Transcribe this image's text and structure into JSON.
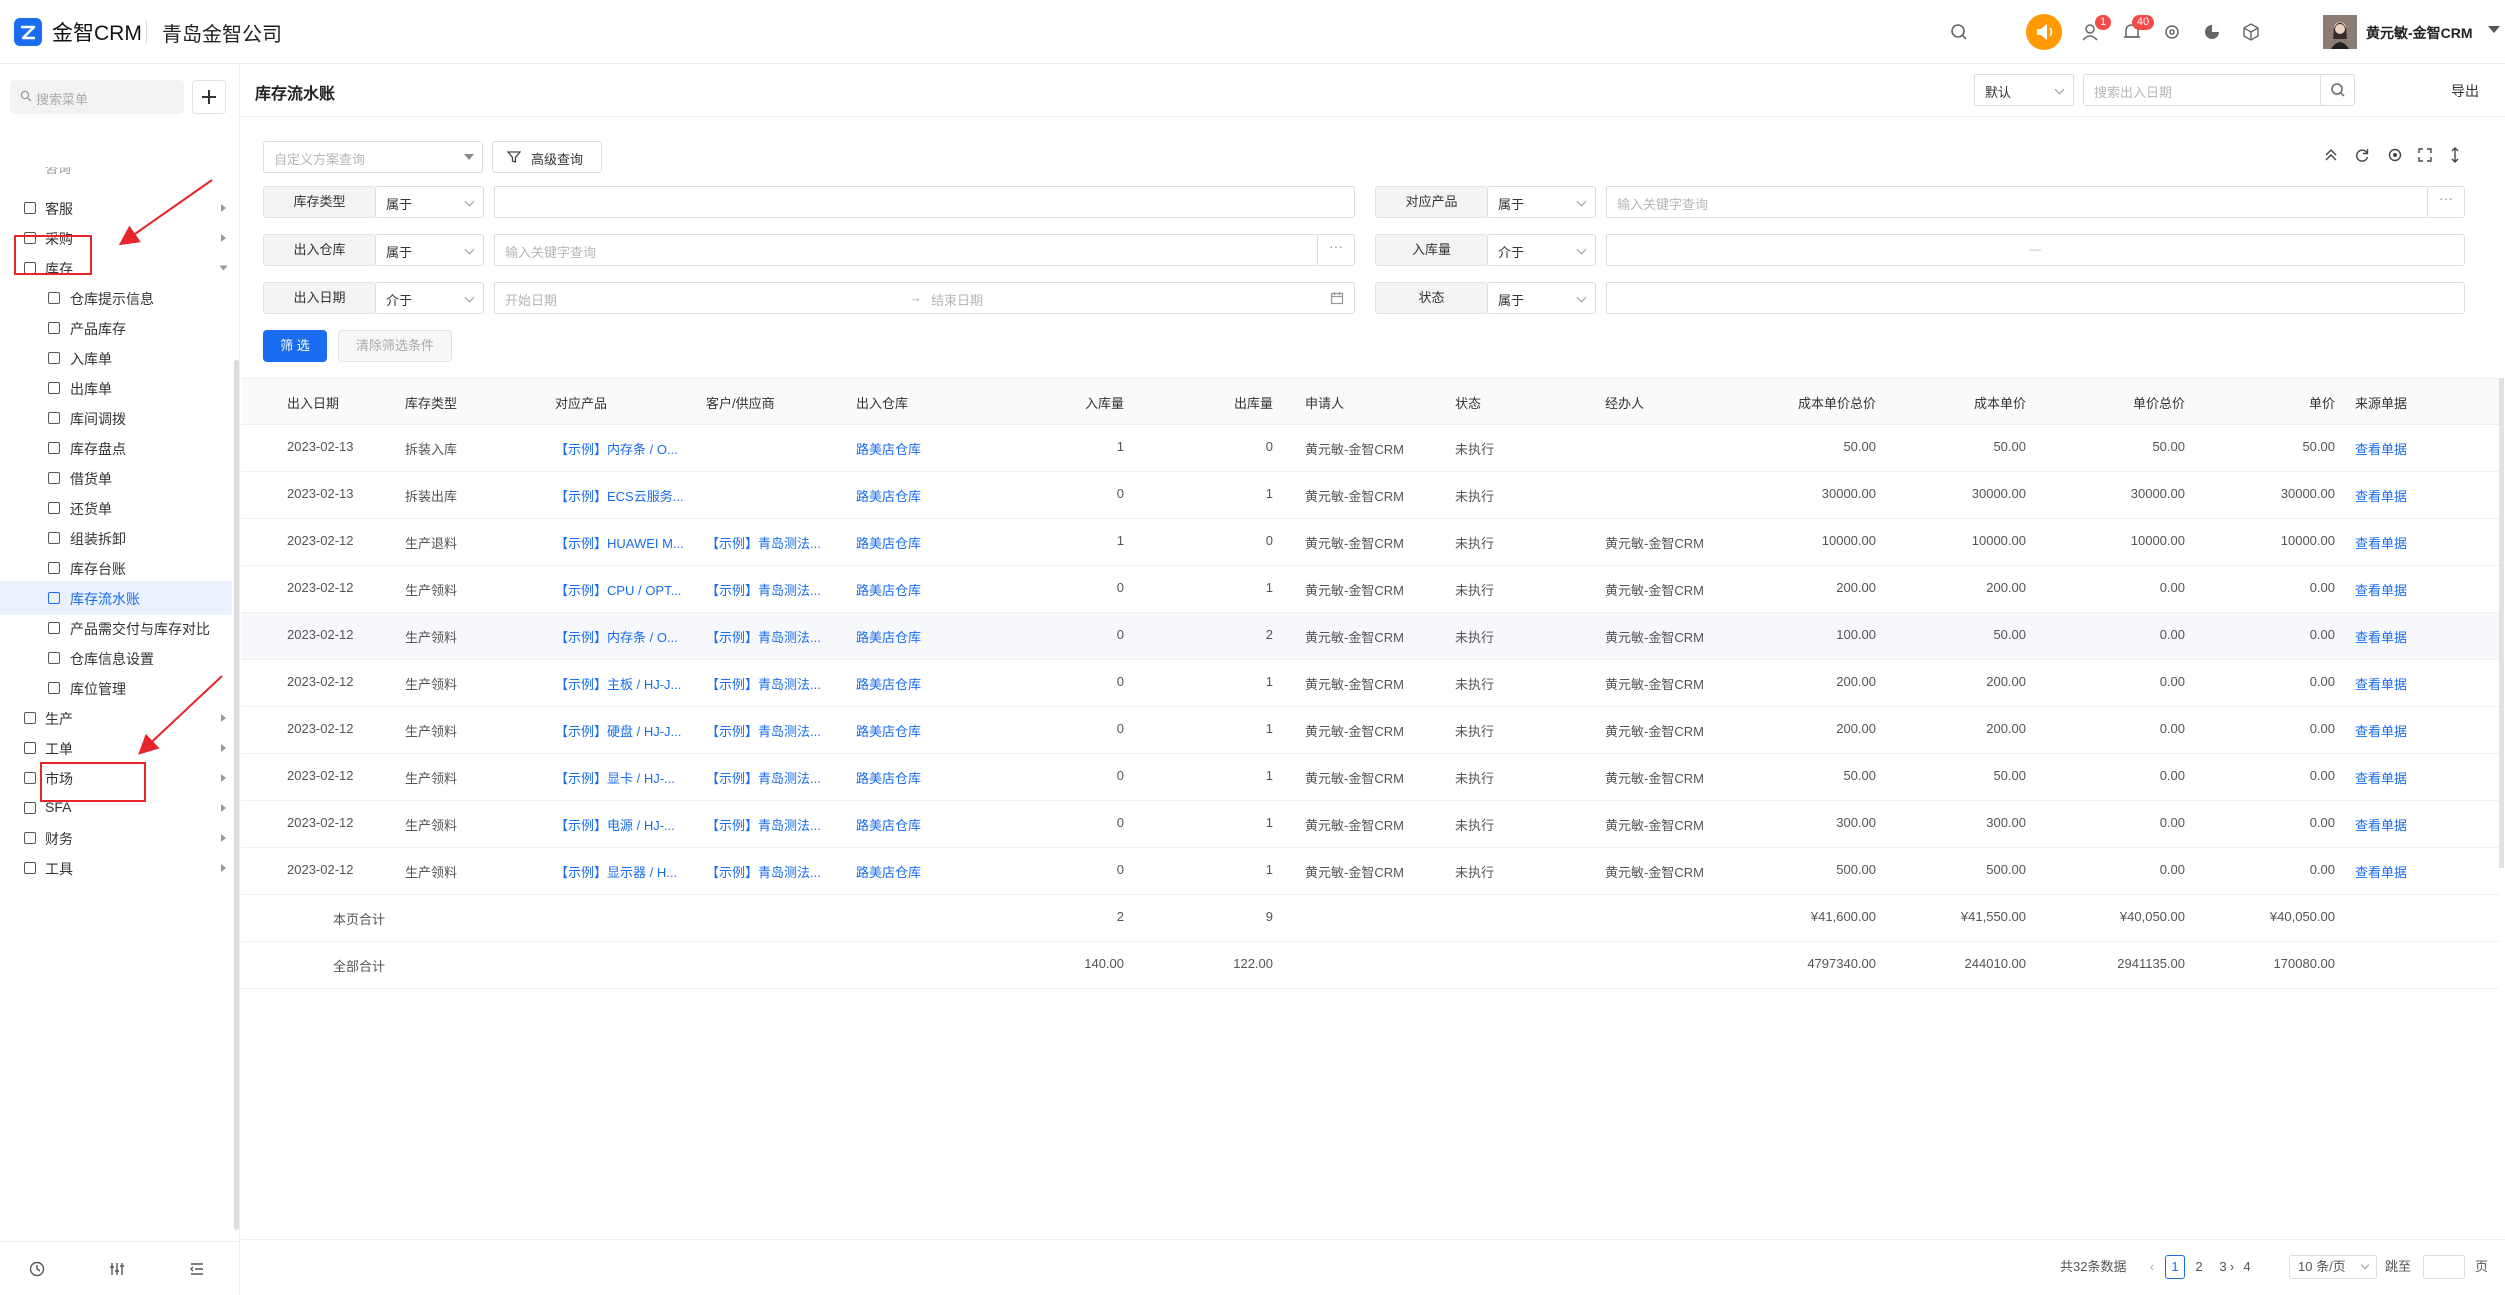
{
  "app": {
    "name": "金智CRM",
    "company": "青岛金智公司"
  },
  "header": {
    "notif_badge_1": "1",
    "notif_badge_2": "40",
    "username": "黄元敏-金智CRM",
    "icons": [
      "search-icon",
      "speaker-icon",
      "users-icon",
      "bell-icon",
      "gear-icon",
      "pie-chart-icon",
      "box-icon"
    ]
  },
  "sidebar": {
    "search_placeholder": "搜索菜单",
    "partial_item": "咨询",
    "items": [
      {
        "label": "客服",
        "level": "top"
      },
      {
        "label": "采购",
        "level": "top"
      },
      {
        "label": "库存",
        "level": "top",
        "expanded": true
      },
      {
        "label": "仓库提示信息",
        "level": "sub"
      },
      {
        "label": "产品库存",
        "level": "sub"
      },
      {
        "label": "入库单",
        "level": "sub"
      },
      {
        "label": "出库单",
        "level": "sub"
      },
      {
        "label": "库间调拨",
        "level": "sub"
      },
      {
        "label": "库存盘点",
        "level": "sub"
      },
      {
        "label": "借货单",
        "level": "sub"
      },
      {
        "label": "还货单",
        "level": "sub"
      },
      {
        "label": "组装拆卸",
        "level": "sub"
      },
      {
        "label": "库存台账",
        "level": "sub"
      },
      {
        "label": "库存流水账",
        "level": "sub",
        "active": true
      },
      {
        "label": "产品需交付与库存对比",
        "level": "sub"
      },
      {
        "label": "仓库信息设置",
        "level": "sub"
      },
      {
        "label": "库位管理",
        "level": "sub"
      },
      {
        "label": "生产",
        "level": "top"
      },
      {
        "label": "工单",
        "level": "top"
      },
      {
        "label": "市场",
        "level": "top"
      },
      {
        "label": "SFA",
        "level": "top"
      },
      {
        "label": "财务",
        "level": "top"
      },
      {
        "label": "工具",
        "level": "top"
      }
    ]
  },
  "page": {
    "title": "库存流水账",
    "view_select": "默认",
    "date_search_placeholder": "搜索出入日期",
    "export": "导出",
    "scheme_placeholder": "自定义方案查询",
    "advanced_query": "高级查询"
  },
  "filters": {
    "stock_type": {
      "label": "库存类型",
      "op": "属于"
    },
    "product": {
      "label": "对应产品",
      "op": "属于",
      "placeholder": "输入关键字查询"
    },
    "warehouse": {
      "label": "出入仓库",
      "op": "属于",
      "placeholder": "输入关键字查询"
    },
    "in_qty": {
      "label": "入库量",
      "op": "介于",
      "sep": "—"
    },
    "date": {
      "label": "出入日期",
      "op": "介于",
      "start": "开始日期",
      "arrow": "→",
      "end": "结束日期"
    },
    "status": {
      "label": "状态",
      "op": "属于"
    },
    "filter_btn": "筛 选",
    "clear_btn": "清除筛选条件"
  },
  "table": {
    "columns": [
      "出入日期",
      "库存类型",
      "对应产品",
      "客户/供应商",
      "出入仓库",
      "入库量",
      "出库量",
      "申请人",
      "状态",
      "经办人",
      "成本单价总价",
      "成本单价",
      "单价总价",
      "单价",
      "来源单据"
    ],
    "rows": [
      [
        "2023-02-13",
        "拆装入库",
        "【示例】内存条 / O...",
        "",
        "路美店仓库",
        "1",
        "0",
        "黄元敏-金智CRM",
        "未执行",
        "",
        "50.00",
        "50.00",
        "50.00",
        "50.00",
        "查看单据"
      ],
      [
        "2023-02-13",
        "拆装出库",
        "【示例】ECS云服务...",
        "",
        "路美店仓库",
        "0",
        "1",
        "黄元敏-金智CRM",
        "未执行",
        "",
        "30000.00",
        "30000.00",
        "30000.00",
        "30000.00",
        "查看单据"
      ],
      [
        "2023-02-12",
        "生产退料",
        "【示例】HUAWEI M...",
        "【示例】青岛测法...",
        "路美店仓库",
        "1",
        "0",
        "黄元敏-金智CRM",
        "未执行",
        "黄元敏-金智CRM",
        "10000.00",
        "10000.00",
        "10000.00",
        "10000.00",
        "查看单据"
      ],
      [
        "2023-02-12",
        "生产领料",
        "【示例】CPU / OPT...",
        "【示例】青岛测法...",
        "路美店仓库",
        "0",
        "1",
        "黄元敏-金智CRM",
        "未执行",
        "黄元敏-金智CRM",
        "200.00",
        "200.00",
        "0.00",
        "0.00",
        "查看单据"
      ],
      [
        "2023-02-12",
        "生产领料",
        "【示例】内存条 / O...",
        "【示例】青岛测法...",
        "路美店仓库",
        "0",
        "2",
        "黄元敏-金智CRM",
        "未执行",
        "黄元敏-金智CRM",
        "100.00",
        "50.00",
        "0.00",
        "0.00",
        "查看单据"
      ],
      [
        "2023-02-12",
        "生产领料",
        "【示例】主板 / HJ-J...",
        "【示例】青岛测法...",
        "路美店仓库",
        "0",
        "1",
        "黄元敏-金智CRM",
        "未执行",
        "黄元敏-金智CRM",
        "200.00",
        "200.00",
        "0.00",
        "0.00",
        "查看单据"
      ],
      [
        "2023-02-12",
        "生产领料",
        "【示例】硬盘 / HJ-J...",
        "【示例】青岛测法...",
        "路美店仓库",
        "0",
        "1",
        "黄元敏-金智CRM",
        "未执行",
        "黄元敏-金智CRM",
        "200.00",
        "200.00",
        "0.00",
        "0.00",
        "查看单据"
      ],
      [
        "2023-02-12",
        "生产领料",
        "【示例】显卡 / HJ-...",
        "【示例】青岛测法...",
        "路美店仓库",
        "0",
        "1",
        "黄元敏-金智CRM",
        "未执行",
        "黄元敏-金智CRM",
        "50.00",
        "50.00",
        "0.00",
        "0.00",
        "查看单据"
      ],
      [
        "2023-02-12",
        "生产领料",
        "【示例】电源 / HJ-...",
        "【示例】青岛测法...",
        "路美店仓库",
        "0",
        "1",
        "黄元敏-金智CRM",
        "未执行",
        "黄元敏-金智CRM",
        "300.00",
        "300.00",
        "0.00",
        "0.00",
        "查看单据"
      ],
      [
        "2023-02-12",
        "生产领料",
        "【示例】显示器 / H...",
        "【示例】青岛测法...",
        "路美店仓库",
        "0",
        "1",
        "黄元敏-金智CRM",
        "未执行",
        "黄元敏-金智CRM",
        "500.00",
        "500.00",
        "0.00",
        "0.00",
        "查看单据"
      ]
    ],
    "page_total": {
      "label": "本页合计",
      "in": "2",
      "out": "9",
      "c1": "¥41,600.00",
      "c2": "¥41,550.00",
      "c3": "¥40,050.00",
      "c4": "¥40,050.00"
    },
    "all_total": {
      "label": "全部合计",
      "in": "140.00",
      "out": "122.00",
      "c1": "4797340.00",
      "c2": "244010.00",
      "c3": "2941135.00",
      "c4": "170080.00"
    }
  },
  "pager": {
    "total": "共32条数据",
    "pages": [
      "1",
      "2",
      "3",
      "4"
    ],
    "current": "1",
    "page_size": "10 条/页",
    "jump": "跳至",
    "page_unit": "页"
  }
}
